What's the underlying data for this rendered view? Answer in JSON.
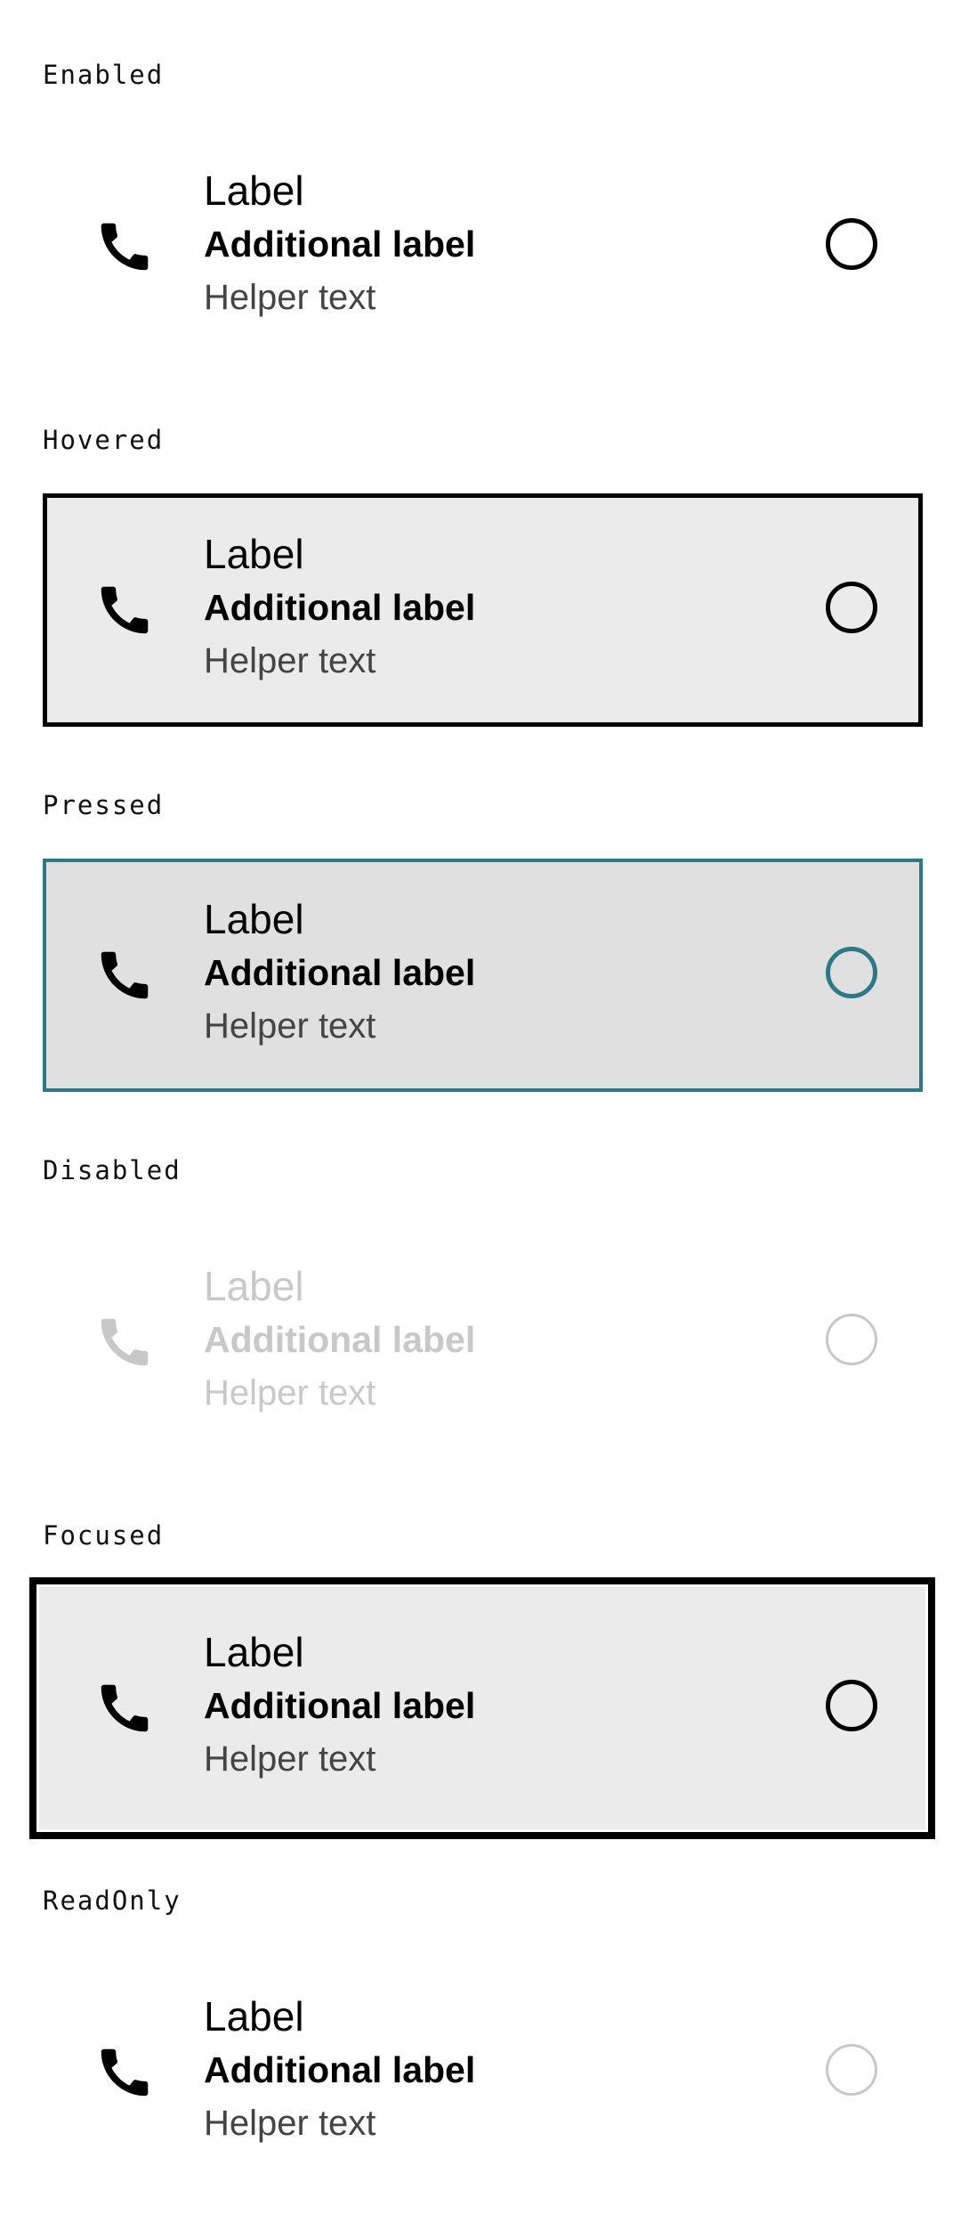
{
  "states": [
    {
      "state": "Enabled",
      "label": "Label",
      "additional_label": "Additional label",
      "helper_text": "Helper text",
      "selected": false
    },
    {
      "state": "Hovered",
      "label": "Label",
      "additional_label": "Additional label",
      "helper_text": "Helper text",
      "selected": false
    },
    {
      "state": "Pressed",
      "label": "Label",
      "additional_label": "Additional label",
      "helper_text": "Helper text",
      "selected": false
    },
    {
      "state": "Disabled",
      "label": "Label",
      "additional_label": "Additional label",
      "helper_text": "Helper text",
      "selected": false
    },
    {
      "state": "Focused",
      "label": "Label",
      "additional_label": "Additional label",
      "helper_text": "Helper text",
      "selected": false
    },
    {
      "state": "ReadOnly",
      "label": "Label",
      "additional_label": "Additional label",
      "helper_text": "Helper text",
      "selected": false
    }
  ],
  "icon": "phone-icon",
  "colors": {
    "text": "#000000",
    "helper": "#444444",
    "disabled": "#c8c8c8",
    "hover_bg": "#ebebeb",
    "pressed_bg": "#e0e0e0",
    "pressed_accent": "#2b7a87"
  }
}
